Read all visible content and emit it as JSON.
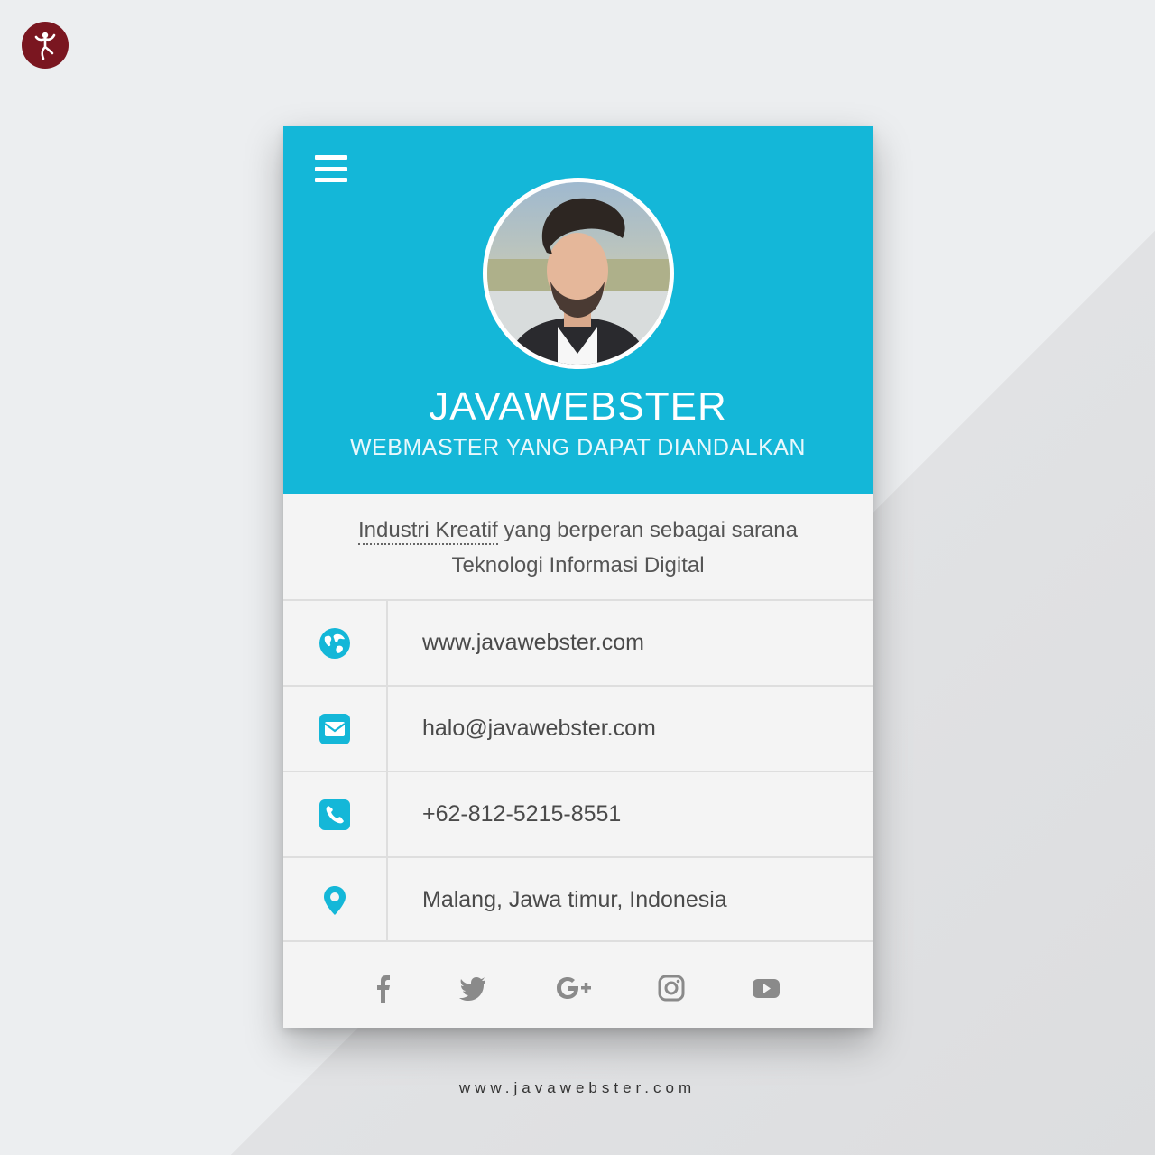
{
  "profile": {
    "name": "JAVAWEBSTER",
    "tagline": "WEBMASTER YANG DAPAT DIANDALKAN"
  },
  "bio": {
    "highlight": "Industri Kreatif",
    "line1_rest": " yang berperan sebagai sarana",
    "line2": "Teknologi Informasi Digital"
  },
  "contacts": [
    {
      "icon": "globe-icon",
      "text": "www.javawebster.com"
    },
    {
      "icon": "email-icon",
      "text": "halo@javawebster.com"
    },
    {
      "icon": "phone-icon",
      "text": "+62-812-5215-8551"
    },
    {
      "icon": "location-pin-icon",
      "text": "Malang, Jawa timur, Indonesia"
    }
  ],
  "social": [
    "facebook-icon",
    "twitter-icon",
    "google-plus-icon",
    "instagram-icon",
    "youtube-icon"
  ],
  "footer": {
    "url": "www.javawebster.com"
  },
  "colors": {
    "accent": "#14b7d8",
    "card_bg": "#f4f4f4",
    "text": "#4a4a4a",
    "social_icon": "#8a8a8a",
    "logo": "#7a1620"
  }
}
